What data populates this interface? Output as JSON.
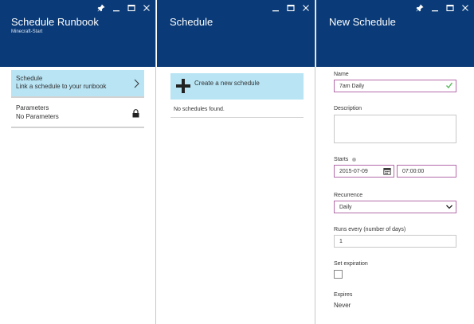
{
  "blade1": {
    "title": "Schedule Runbook",
    "subtitle": "Minecraft-Start",
    "schedule_item": {
      "label": "Schedule",
      "value": "Link a schedule to your runbook"
    },
    "parameters_item": {
      "label": "Parameters",
      "value": "No Parameters"
    }
  },
  "blade2": {
    "title": "Schedule",
    "create_label": "Create a new schedule",
    "empty_text": "No schedules found."
  },
  "blade3": {
    "title": "New Schedule",
    "name_label": "Name",
    "name_value": "7am Daily",
    "description_label": "Description",
    "description_value": "",
    "starts_label": "Starts",
    "start_date": "2015-07-09",
    "start_time": "07:00:00",
    "recurrence_label": "Recurrence",
    "recurrence_value": "Daily",
    "runs_every_label": "Runs every (number of days)",
    "runs_every_value": "1",
    "set_expiration_label": "Set expiration",
    "expires_label": "Expires",
    "expires_value": "Never"
  },
  "icons": {
    "pin": "pin-icon",
    "minimize": "minimize-icon",
    "maximize": "maximize-icon",
    "close": "close-icon",
    "chevron": "chevron-right-icon",
    "lock": "lock-icon",
    "plus": "plus-icon",
    "check": "checkmark-icon",
    "calendar": "calendar-icon",
    "dropdown": "chevron-down-icon",
    "info": "info-icon"
  },
  "colors": {
    "header": "#0a3b78",
    "selected": "#b8e4f4",
    "focus_border": "#b46cab",
    "valid_check": "#5cb85c"
  }
}
